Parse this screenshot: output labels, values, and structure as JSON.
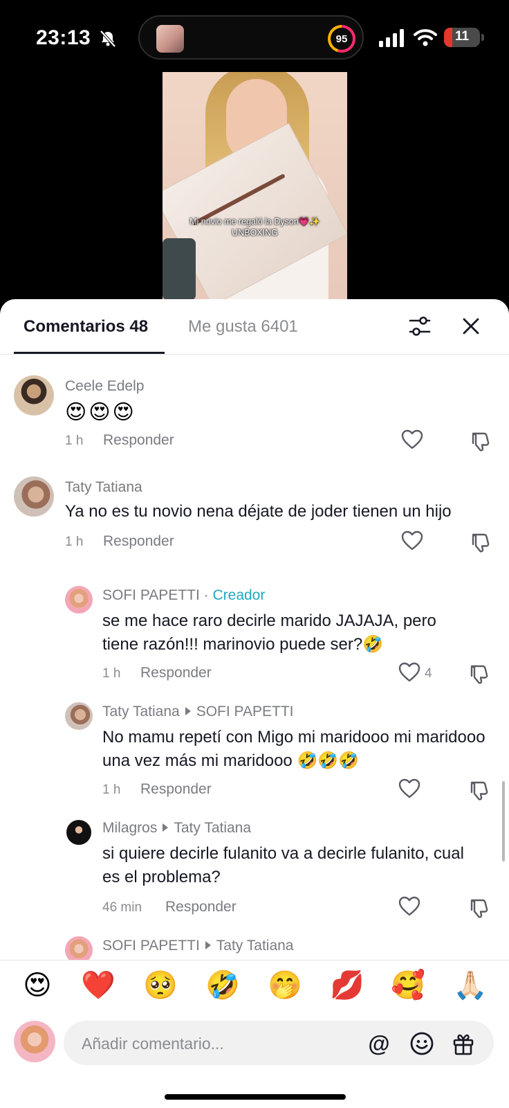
{
  "status_bar": {
    "time": "23:13",
    "activity_ring": "95",
    "battery": "11",
    "battery_level": 0.11
  },
  "video": {
    "caption_line1": "Mi novio me regaló la Dyson💗✨",
    "caption_line2": "UNBOXING"
  },
  "tabs": {
    "comments": "Comentarios 48",
    "likes": "Me gusta 6401"
  },
  "comments": [
    {
      "name": "Ceele Edelp",
      "text": "😍😍😍",
      "time": "1 h",
      "reply": "Responder",
      "likes": ""
    },
    {
      "name": "Taty Tatiana",
      "text": "Ya no es tu novio nena déjate de joder tienen un hijo",
      "time": "1 h",
      "reply": "Responder",
      "likes": ""
    },
    {
      "name": "SOFI PAPETTI",
      "badge": "Creador",
      "text": "se me hace raro decirle marido JAJAJA, pero tiene razón!!! marinovio puede ser?🤣",
      "time": "1 h",
      "reply": "Responder",
      "likes": "4"
    },
    {
      "name": "Taty Tatiana",
      "reply_to": "SOFI PAPETTI",
      "text": "No mamu repetí con Migo mi maridooo mi maridooo una vez más mi maridooo 🤣🤣🤣",
      "time": "1 h",
      "reply": "Responder",
      "likes": ""
    },
    {
      "name": "Milagros",
      "reply_to": "Taty Tatiana",
      "text": "si quiere decirle fulanito va a decirle fulanito, cual es el problema?",
      "time": "46 min",
      "reply": "Responder",
      "likes": ""
    },
    {
      "name": "SOFI PAPETTI",
      "reply_to": "Taty Tatiana"
    }
  ],
  "separator": "·",
  "emoji_bar": [
    "😍",
    "❤️",
    "🥺",
    "🤣",
    "🤭",
    "💋",
    "🥰",
    "🙏🏻"
  ],
  "composer": {
    "placeholder": "Añadir comentario...",
    "at": "@"
  },
  "colors": {
    "creator_badge": "#20a8c0",
    "battery_low": "#e3372f",
    "text_primary": "#161823",
    "text_secondary": "#7a7b82"
  },
  "icons": [
    "bell-slash-icon",
    "signal-icon",
    "wifi-icon",
    "battery-icon",
    "filter-icon",
    "close-icon",
    "heart-icon",
    "dislike-icon",
    "at-icon",
    "smile-icon",
    "gift-icon"
  ]
}
